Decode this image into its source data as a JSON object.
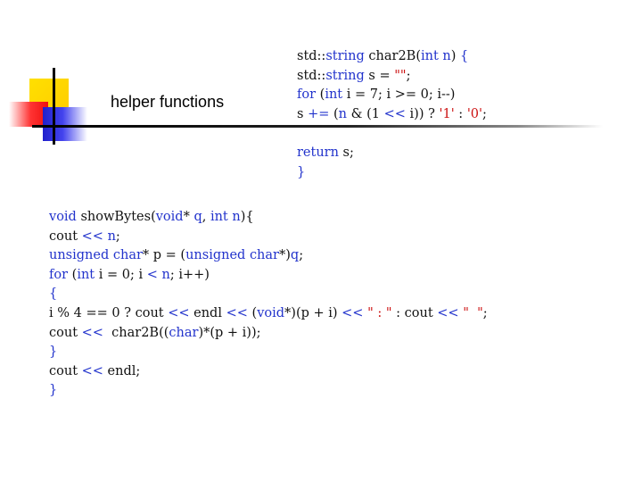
{
  "slide": {
    "title": "helper functions"
  },
  "colors": {
    "keyword": "#2233cc",
    "string": "#cc1111",
    "text": "#111111",
    "accent_yellow": "#ffcc00",
    "accent_red": "#ee1111",
    "accent_blue": "#2020cc"
  },
  "code_top": [
    [
      {
        "t": "std::",
        "c": "plain"
      },
      {
        "t": "string",
        "c": "kw"
      },
      {
        "t": " char2B(",
        "c": "plain"
      },
      {
        "t": "int",
        "c": "kw"
      },
      {
        "t": " n",
        "c": "kw"
      },
      {
        "t": ")",
        "c": "plain"
      },
      {
        "t": " {",
        "c": "kw"
      }
    ],
    [
      {
        "t": "std::",
        "c": "plain"
      },
      {
        "t": "string",
        "c": "kw"
      },
      {
        "t": " s = ",
        "c": "plain"
      },
      {
        "t": "\"\"",
        "c": "str"
      },
      {
        "t": ";",
        "c": "plain"
      }
    ],
    [
      {
        "t": "for",
        "c": "kw"
      },
      {
        "t": " (",
        "c": "plain"
      },
      {
        "t": "int",
        "c": "kw"
      },
      {
        "t": " i = 7; i >= 0; i--)",
        "c": "plain"
      }
    ],
    [
      {
        "t": "s ",
        "c": "plain"
      },
      {
        "t": "+=",
        "c": "kw"
      },
      {
        "t": " (",
        "c": "plain"
      },
      {
        "t": "n",
        "c": "kw"
      },
      {
        "t": " & (1 ",
        "c": "plain"
      },
      {
        "t": "<<",
        "c": "kw"
      },
      {
        "t": " i)) ? ",
        "c": "plain"
      },
      {
        "t": "'1'",
        "c": "str"
      },
      {
        "t": " : ",
        "c": "plain"
      },
      {
        "t": "'0'",
        "c": "str"
      },
      {
        "t": ";",
        "c": "plain"
      }
    ],
    [
      {
        "t": " ",
        "c": "plain"
      }
    ],
    [
      {
        "t": "return",
        "c": "kw"
      },
      {
        "t": " s;",
        "c": "plain"
      }
    ],
    [
      {
        "t": "}",
        "c": "kw"
      }
    ]
  ],
  "code_bottom": [
    [
      {
        "t": "void",
        "c": "kw"
      },
      {
        "t": " showBytes(",
        "c": "plain"
      },
      {
        "t": "void",
        "c": "kw"
      },
      {
        "t": "* ",
        "c": "plain"
      },
      {
        "t": "q",
        "c": "kw"
      },
      {
        "t": ", ",
        "c": "plain"
      },
      {
        "t": "int",
        "c": "kw"
      },
      {
        "t": " ",
        "c": "plain"
      },
      {
        "t": "n",
        "c": "kw"
      },
      {
        "t": "){",
        "c": "plain"
      }
    ],
    [
      {
        "t": "cout ",
        "c": "plain"
      },
      {
        "t": "<<",
        "c": "kw"
      },
      {
        "t": " ",
        "c": "plain"
      },
      {
        "t": "n",
        "c": "kw"
      },
      {
        "t": ";",
        "c": "plain"
      }
    ],
    [
      {
        "t": "unsigned",
        "c": "kw"
      },
      {
        "t": " ",
        "c": "plain"
      },
      {
        "t": "char",
        "c": "kw"
      },
      {
        "t": "* p = (",
        "c": "plain"
      },
      {
        "t": "unsigned",
        "c": "kw"
      },
      {
        "t": " ",
        "c": "plain"
      },
      {
        "t": "char",
        "c": "kw"
      },
      {
        "t": "*)",
        "c": "plain"
      },
      {
        "t": "q",
        "c": "kw"
      },
      {
        "t": ";",
        "c": "plain"
      }
    ],
    [
      {
        "t": "for",
        "c": "kw"
      },
      {
        "t": " (",
        "c": "plain"
      },
      {
        "t": "int",
        "c": "kw"
      },
      {
        "t": " i = 0; i ",
        "c": "plain"
      },
      {
        "t": "<",
        "c": "kw"
      },
      {
        "t": " ",
        "c": "plain"
      },
      {
        "t": "n",
        "c": "kw"
      },
      {
        "t": "; i++)",
        "c": "plain"
      }
    ],
    [
      {
        "t": "{",
        "c": "kw"
      }
    ],
    [
      {
        "t": "i % 4 == 0 ? cout ",
        "c": "plain"
      },
      {
        "t": "<<",
        "c": "kw"
      },
      {
        "t": " endl ",
        "c": "plain"
      },
      {
        "t": "<<",
        "c": "kw"
      },
      {
        "t": " (",
        "c": "plain"
      },
      {
        "t": "void",
        "c": "kw"
      },
      {
        "t": "*)(p + i) ",
        "c": "plain"
      },
      {
        "t": "<<",
        "c": "kw"
      },
      {
        "t": " ",
        "c": "plain"
      },
      {
        "t": "\" : \"",
        "c": "str"
      },
      {
        "t": " : cout ",
        "c": "plain"
      },
      {
        "t": "<<",
        "c": "kw"
      },
      {
        "t": " ",
        "c": "plain"
      },
      {
        "t": "\"  \"",
        "c": "str"
      },
      {
        "t": ";",
        "c": "plain"
      }
    ],
    [
      {
        "t": "cout ",
        "c": "plain"
      },
      {
        "t": "<<",
        "c": "kw"
      },
      {
        "t": "  char2B((",
        "c": "plain"
      },
      {
        "t": "char",
        "c": "kw"
      },
      {
        "t": ")*(p + i));",
        "c": "plain"
      }
    ],
    [
      {
        "t": "}",
        "c": "kw"
      }
    ],
    [
      {
        "t": "cout ",
        "c": "plain"
      },
      {
        "t": "<<",
        "c": "kw"
      },
      {
        "t": " endl;",
        "c": "plain"
      }
    ],
    [
      {
        "t": "}",
        "c": "kw"
      }
    ]
  ]
}
